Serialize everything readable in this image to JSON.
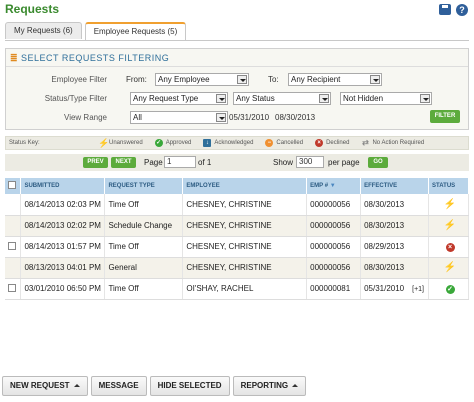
{
  "page": {
    "title": "Requests"
  },
  "tabs": [
    {
      "label": "My Requests (6)",
      "active": false
    },
    {
      "label": "Employee Requests (5)",
      "active": true
    }
  ],
  "filter": {
    "heading": "SELECT REQUESTS FILTERING",
    "employee_filter_label": "Employee Filter",
    "from_label": "From:",
    "from_value": "Any Employee",
    "to_label": "To:",
    "to_value": "Any Recipient",
    "status_type_label": "Status/Type Filter",
    "request_type_value": "Any Request Type",
    "status_value": "Any Status",
    "hidden_value": "Not Hidden",
    "view_range_label": "View Range",
    "view_range_value": "All",
    "date_from": "05/31/2010",
    "date_to": "08/30/2013",
    "filter_button": "FILTER"
  },
  "status_key": {
    "label": "Status Key:",
    "items": [
      {
        "label": "Unanswered",
        "icon": "lightning-icon",
        "color": "#f0a020"
      },
      {
        "label": "Approved",
        "icon": "check-icon",
        "color": "#3aa83a"
      },
      {
        "label": "Acknowledged",
        "icon": "download-icon",
        "color": "#2f6f9a"
      },
      {
        "label": "Cancelled",
        "icon": "minus-icon",
        "color": "#f09030"
      },
      {
        "label": "Declined",
        "icon": "x-icon",
        "color": "#c0392b"
      },
      {
        "label": "No Action Required",
        "icon": "swap-icon",
        "color": "#888888"
      }
    ]
  },
  "pager": {
    "prev": "PREV",
    "next": "NEXT",
    "page_label": "Page",
    "page_value": "1",
    "of_label": "of 1",
    "show_label": "Show",
    "show_value": "300",
    "per_page_label": "per page",
    "go": "GO"
  },
  "table": {
    "columns": [
      "SUBMITTED",
      "REQUEST TYPE",
      "EMPLOYEE",
      "EMP #",
      "EFFECTIVE",
      "STATUS"
    ],
    "rows": [
      {
        "submitted": "08/14/2013 02:03 PM",
        "type": "Time Off",
        "employee": "CHESNEY, CHRISTINE",
        "emp": "000000056",
        "effective": "08/30/2013",
        "extra": "",
        "status": "Unanswered",
        "checkbox": false
      },
      {
        "submitted": "08/14/2013 02:02 PM",
        "type": "Schedule Change",
        "employee": "CHESNEY, CHRISTINE",
        "emp": "000000056",
        "effective": "08/30/2013",
        "extra": "",
        "status": "Unanswered",
        "checkbox": false
      },
      {
        "submitted": "08/14/2013 01:57 PM",
        "type": "Time Off",
        "employee": "CHESNEY, CHRISTINE",
        "emp": "000000056",
        "effective": "08/29/2013",
        "extra": "",
        "status": "Declined",
        "checkbox": true
      },
      {
        "submitted": "08/13/2013 04:01 PM",
        "type": "General",
        "employee": "CHESNEY, CHRISTINE",
        "emp": "000000056",
        "effective": "08/30/2013",
        "extra": "",
        "status": "Unanswered",
        "checkbox": false
      },
      {
        "submitted": "03/01/2010 06:50 PM",
        "type": "Time Off",
        "employee": "OI'SHAY, RACHEL",
        "emp": "000000081",
        "effective": "05/31/2010",
        "extra": "[+1]",
        "status": "Approved",
        "checkbox": true
      }
    ]
  },
  "bottom_buttons": [
    {
      "label": "NEW REQUEST",
      "caret": true
    },
    {
      "label": "MESSAGE",
      "caret": false
    },
    {
      "label": "HIDE SELECTED",
      "caret": false
    },
    {
      "label": "REPORTING",
      "caret": true
    }
  ]
}
